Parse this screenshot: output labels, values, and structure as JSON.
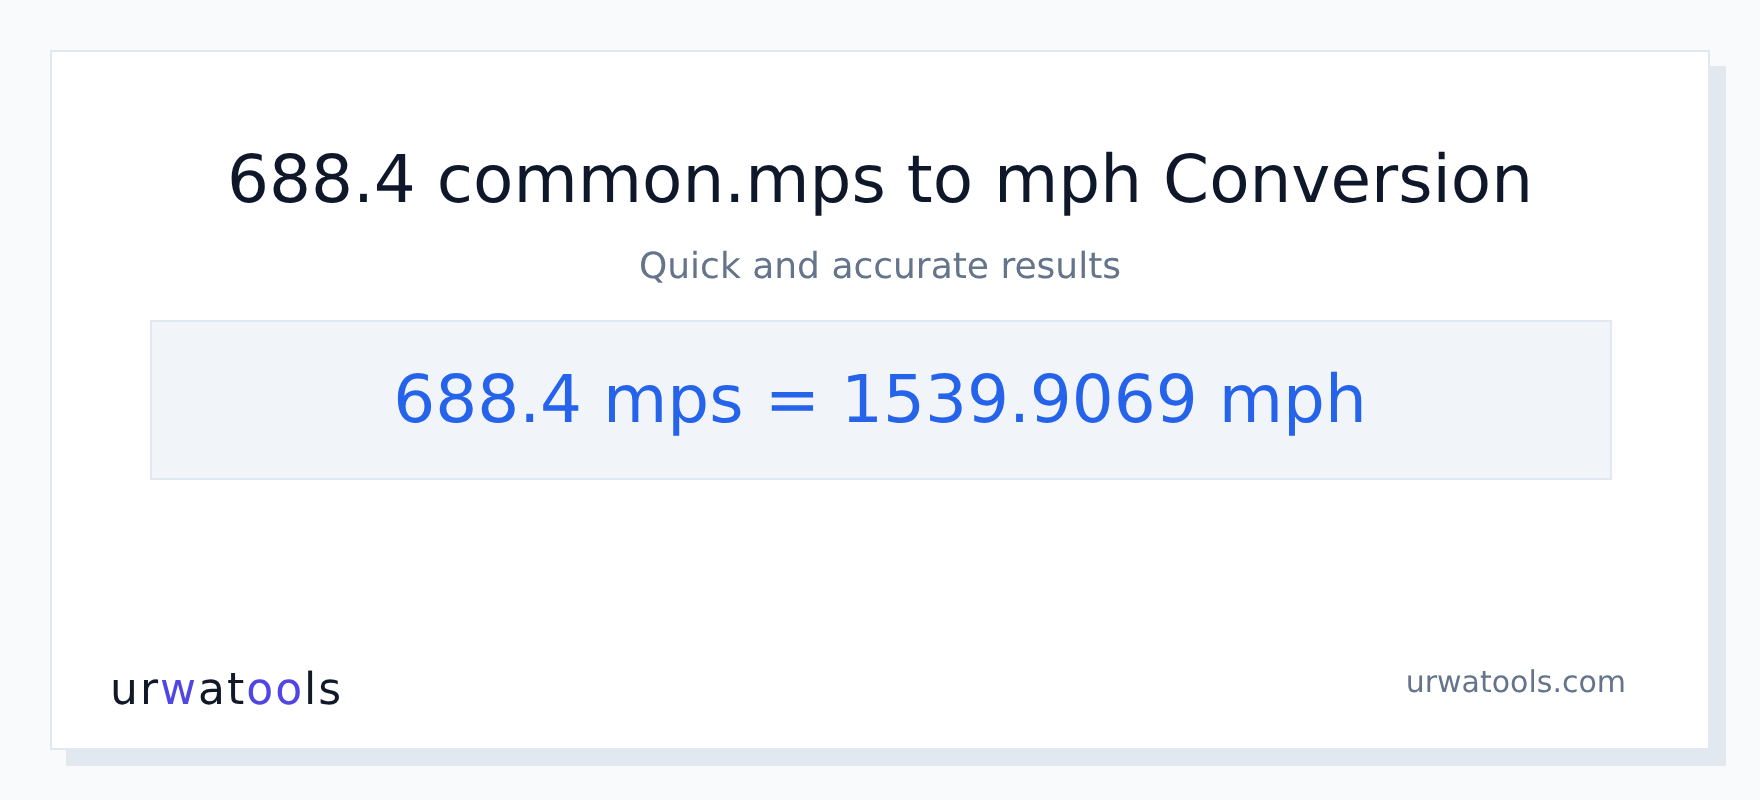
{
  "title": "688.4 common.mps to mph Conversion",
  "subtitle": "Quick and accurate results",
  "result": "688.4 mps = 1539.9069 mph",
  "logo": [
    {
      "text": "ur",
      "accent": false
    },
    {
      "text": "w",
      "accent": true
    },
    {
      "text": "at",
      "accent": false
    },
    {
      "text": "oo",
      "accent": true
    },
    {
      "text": "ls",
      "accent": false
    }
  ],
  "site": "urwatools.com"
}
